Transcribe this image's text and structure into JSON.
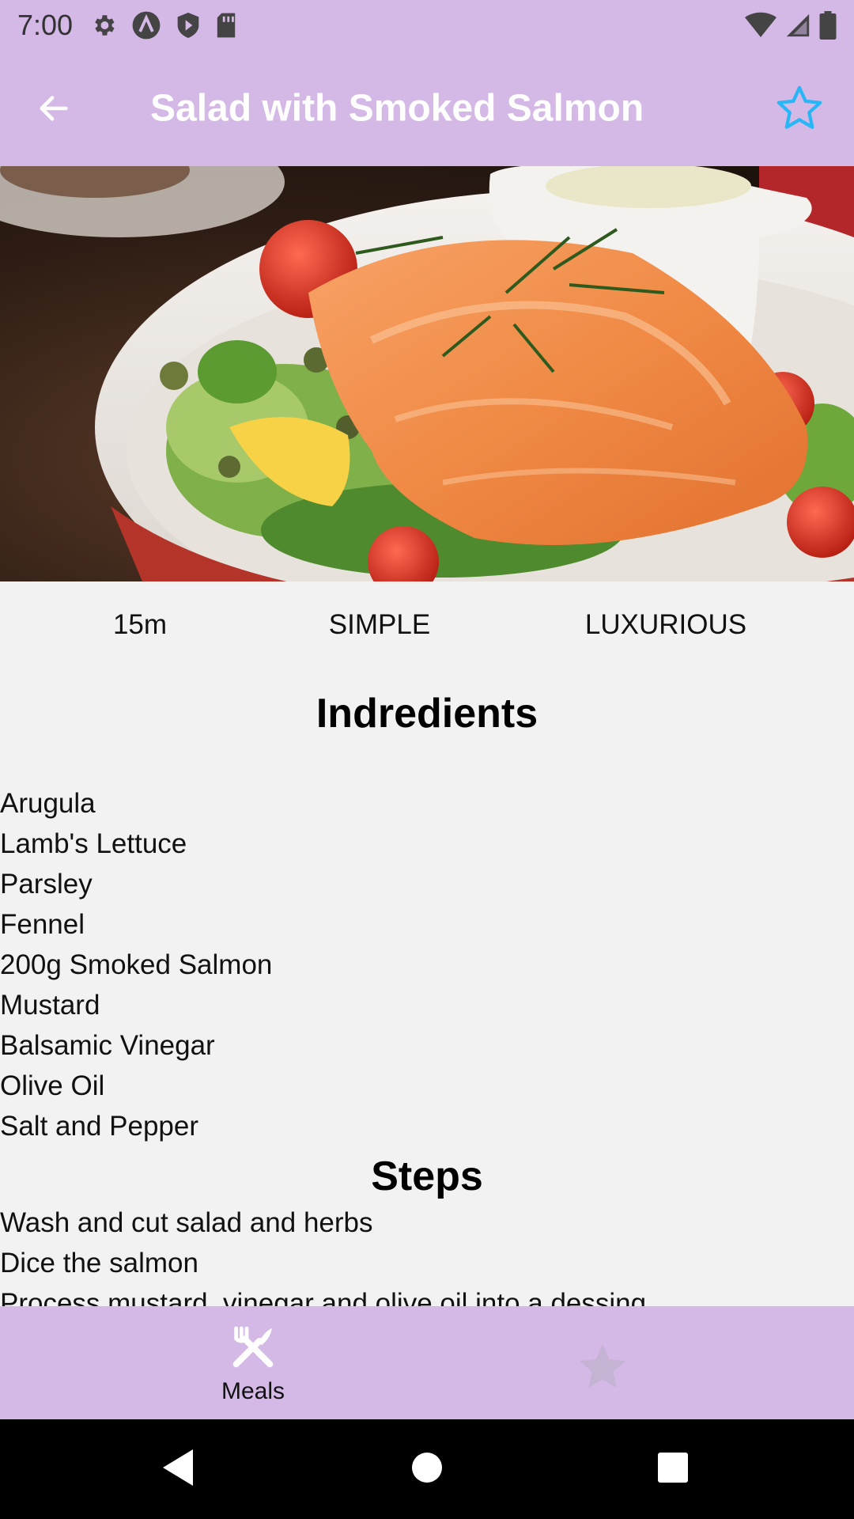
{
  "status_bar": {
    "time": "7:00",
    "icons": [
      "gear-icon",
      "a-circle-icon",
      "play-shield-icon",
      "sd-card-icon"
    ],
    "right_icons": [
      "wifi-icon",
      "signal-icon",
      "battery-icon"
    ]
  },
  "app_bar": {
    "title": "Salad with Smoked Salmon",
    "back_icon": "arrow-left-icon",
    "favorite_icon": "star-outline-icon",
    "favorite_color": "#29b6f6",
    "background": "#d4b8e6"
  },
  "hero": {
    "icon": "salmon-salad-photo"
  },
  "meta": {
    "duration": "15m",
    "complexity": "SIMPLE",
    "affordability": "LUXURIOUS"
  },
  "ingredients": {
    "title": "Indredients",
    "items": [
      "Arugula",
      "Lamb's Lettuce",
      "Parsley",
      "Fennel",
      "200g Smoked Salmon",
      "Mustard",
      "Balsamic Vinegar",
      "Olive Oil",
      "Salt and Pepper"
    ]
  },
  "steps": {
    "title": "Steps",
    "items": [
      "Wash and cut salad and herbs",
      "Dice the salmon",
      "Process mustard, vinegar and olive oil into a dessing"
    ]
  },
  "bottom_nav": {
    "meals_label": "Meals",
    "meals_icon": "fork-knife-icon",
    "favorites_icon": "star-icon"
  },
  "system_nav": {
    "icons": [
      "back-triangle-icon",
      "home-circle-icon",
      "recents-square-icon"
    ]
  }
}
